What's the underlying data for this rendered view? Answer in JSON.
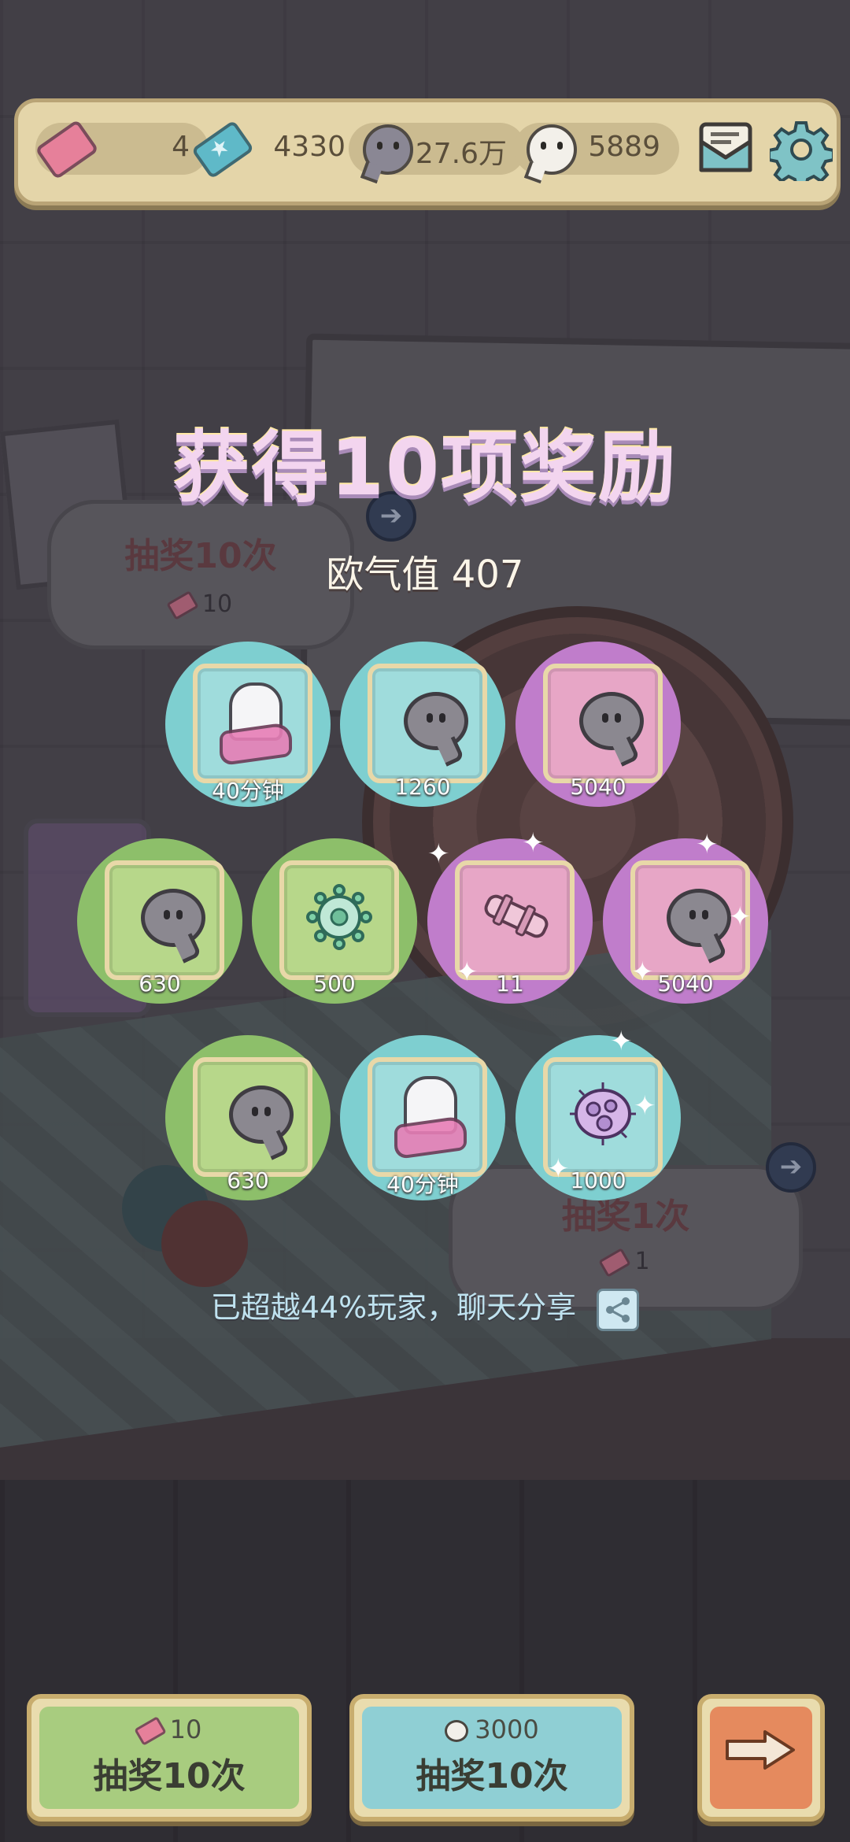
{
  "topbar": {
    "ticket_pink_count": "4",
    "ticket_cyan_count": "4330",
    "grey_bubble_count": "27.6万",
    "white_bubble_count": "5889"
  },
  "background": {
    "draw10_title": "抽奖10次",
    "draw10_cost": "10",
    "draw1_title": "抽奖1次",
    "draw1_cost": "1"
  },
  "result": {
    "title": "获得10项奖励",
    "luck": "欧气值 407",
    "share_text": "已超越44%玩家，聊天分享"
  },
  "rewards": [
    {
      "item": "ghost",
      "amount": "40分钟",
      "tier": "blue"
    },
    {
      "item": "grey-bubble",
      "amount": "1260",
      "tier": "blue"
    },
    {
      "item": "grey-bubble",
      "amount": "5040",
      "tier": "purple"
    },
    {
      "item": "grey-bubble",
      "amount": "630",
      "tier": "green"
    },
    {
      "item": "virus",
      "amount": "500",
      "tier": "green"
    },
    {
      "item": "tube",
      "amount": "11",
      "tier": "purple"
    },
    {
      "item": "grey-bubble",
      "amount": "5040",
      "tier": "purple"
    },
    {
      "item": "grey-bubble",
      "amount": "630",
      "tier": "green"
    },
    {
      "item": "ghost",
      "amount": "40分钟",
      "tier": "blue"
    },
    {
      "item": "germ",
      "amount": "1000",
      "tier": "blue"
    }
  ],
  "buttons": {
    "ticket_draw": {
      "cost": "10",
      "label": "抽奖10次"
    },
    "bubble_draw": {
      "cost": "3000",
      "label": "抽奖10次"
    }
  },
  "colors": {
    "tier_blue": "#7ecfd0",
    "tier_purple": "#c07dcb",
    "tier_green": "#8dbf6a"
  }
}
